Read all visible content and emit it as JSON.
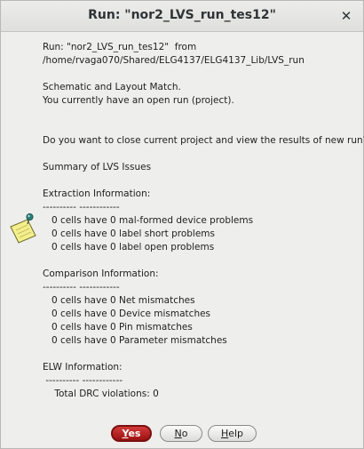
{
  "window": {
    "title": "Run: \"nor2_LVS_run_tes12\"",
    "close_glyph": "✕"
  },
  "message": {
    "lines": [
      "Run: \"nor2_LVS_run_tes12\"  from",
      "/home/rvaga070/Shared/ELG4137/ELG4137_Lib/LVS_run",
      "",
      "Schematic and Layout Match.",
      "You currently have an open run (project).",
      "",
      "",
      "Do you want to close current project and view the results of new run?",
      "",
      "Summary of LVS Issues",
      "",
      "Extraction Information:",
      "---------- ------------",
      "   0 cells have 0 mal-formed device problems",
      "   0 cells have 0 label short problems",
      "   0 cells have 0 label open problems",
      "",
      "Comparison Information:",
      "---------- ------------",
      "   0 cells have 0 Net mismatches",
      "   0 cells have 0 Device mismatches",
      "   0 cells have 0 Pin mismatches",
      "   0 cells have 0 Parameter mismatches",
      "",
      "ELW Information:",
      " ---------- ------------",
      "    Total DRC violations: 0"
    ]
  },
  "buttons": {
    "yes": {
      "label": "Yes",
      "mnemonic": "Y",
      "rest": "es"
    },
    "no": {
      "label": "No",
      "mnemonic": "N",
      "rest": "o"
    },
    "help": {
      "label": "Help",
      "mnemonic": "H",
      "rest": "elp"
    }
  },
  "colors": {
    "default_button": "#b01a1a",
    "note_paper": "#f4ef8a",
    "pin": "#2a7f7a"
  },
  "icons": {
    "note": "note-pin-icon"
  }
}
